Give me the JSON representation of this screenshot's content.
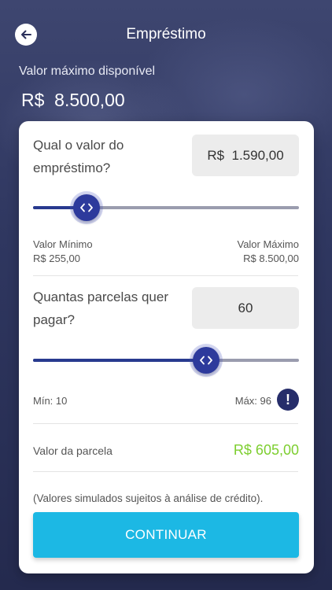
{
  "header": {
    "title": "Empréstimo",
    "back_icon": "arrow-left-icon"
  },
  "available": {
    "label": "Valor máximo disponível",
    "value": "R$  8.500,00"
  },
  "loan": {
    "question": "Qual o valor do empréstimo?",
    "value": "R$  1.590,00",
    "slider_fraction": 0.2,
    "min_label": "Valor Mínimo",
    "min_value": "R$ 255,00",
    "max_label": "Valor Máximo",
    "max_value": "R$ 8.500,00"
  },
  "installments": {
    "question": "Quantas parcelas quer pagar?",
    "value": "60",
    "slider_fraction": 0.65,
    "min_text": "Mín: 10",
    "max_text": "Máx: 96",
    "info_icon": "exclamation-icon"
  },
  "result": {
    "label": "Valor da parcela",
    "value": "R$ 605,00"
  },
  "disclaimer": "(Valores simulados sujeitos à análise de crédito).",
  "continue_label": "CONTINUAR",
  "colors": {
    "accent": "#1cb8e4",
    "slider": "#283a8f",
    "installment_value": "#7dce2f",
    "background": "#262d52"
  }
}
